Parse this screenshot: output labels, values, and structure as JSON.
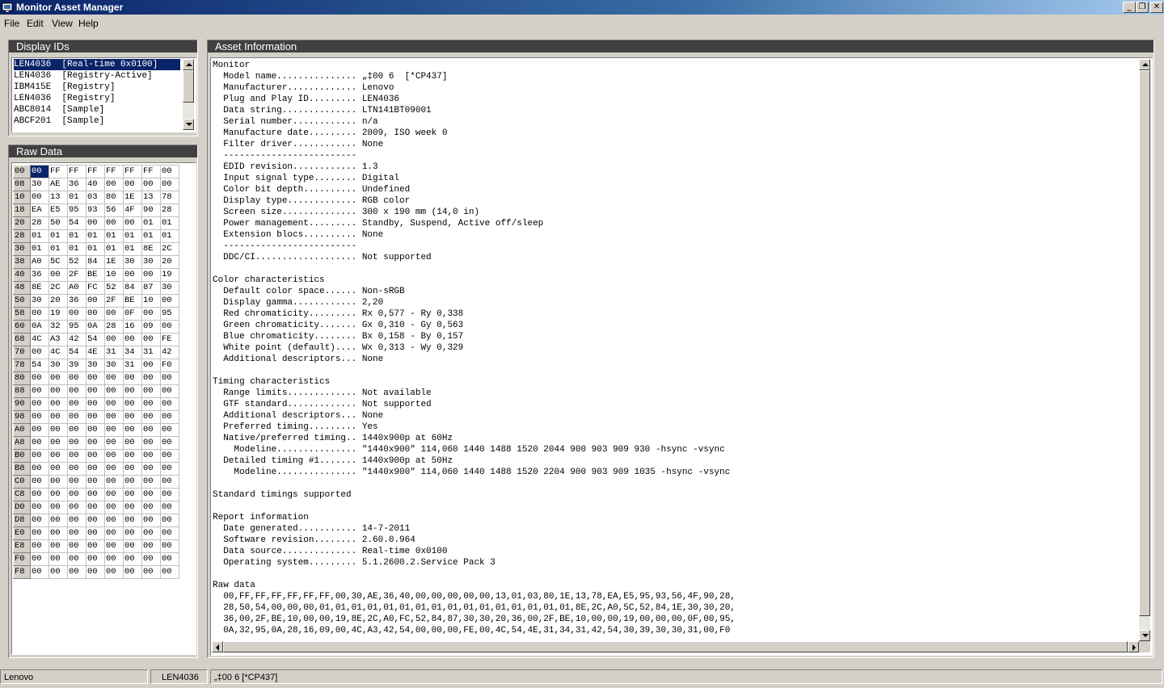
{
  "window": {
    "title": "Monitor Asset Manager"
  },
  "menu": {
    "file": "File",
    "edit": "Edit",
    "view": "View",
    "help": "Help"
  },
  "display_ids": {
    "title": "Display IDs",
    "items": [
      {
        "id": "LEN4036",
        "source": "[Real-time 0x0100]",
        "selected": true
      },
      {
        "id": "LEN4036",
        "source": "[Registry-Active]"
      },
      {
        "id": "IBM415E",
        "source": "[Registry]"
      },
      {
        "id": "LEN4036",
        "source": "[Registry]"
      },
      {
        "id": "ABC8014",
        "source": "[Sample]"
      },
      {
        "id": "ABCF201",
        "source": "[Sample]"
      }
    ]
  },
  "raw_data": {
    "title": "Raw Data",
    "rows": [
      {
        "addr": "00",
        "bytes": [
          "00",
          "FF",
          "FF",
          "FF",
          "FF",
          "FF",
          "FF",
          "00"
        ]
      },
      {
        "addr": "08",
        "bytes": [
          "30",
          "AE",
          "36",
          "40",
          "00",
          "00",
          "00",
          "00"
        ]
      },
      {
        "addr": "10",
        "bytes": [
          "00",
          "13",
          "01",
          "03",
          "80",
          "1E",
          "13",
          "78"
        ]
      },
      {
        "addr": "18",
        "bytes": [
          "EA",
          "E5",
          "95",
          "93",
          "56",
          "4F",
          "90",
          "28"
        ]
      },
      {
        "addr": "20",
        "bytes": [
          "28",
          "50",
          "54",
          "00",
          "00",
          "00",
          "01",
          "01"
        ]
      },
      {
        "addr": "28",
        "bytes": [
          "01",
          "01",
          "01",
          "01",
          "01",
          "01",
          "01",
          "01"
        ]
      },
      {
        "addr": "30",
        "bytes": [
          "01",
          "01",
          "01",
          "01",
          "01",
          "01",
          "8E",
          "2C"
        ]
      },
      {
        "addr": "38",
        "bytes": [
          "A0",
          "5C",
          "52",
          "84",
          "1E",
          "30",
          "30",
          "20"
        ]
      },
      {
        "addr": "40",
        "bytes": [
          "36",
          "00",
          "2F",
          "BE",
          "10",
          "00",
          "00",
          "19"
        ]
      },
      {
        "addr": "48",
        "bytes": [
          "8E",
          "2C",
          "A0",
          "FC",
          "52",
          "84",
          "87",
          "30"
        ]
      },
      {
        "addr": "50",
        "bytes": [
          "30",
          "20",
          "36",
          "00",
          "2F",
          "BE",
          "10",
          "00"
        ]
      },
      {
        "addr": "58",
        "bytes": [
          "00",
          "19",
          "00",
          "00",
          "00",
          "0F",
          "00",
          "95"
        ]
      },
      {
        "addr": "60",
        "bytes": [
          "0A",
          "32",
          "95",
          "0A",
          "28",
          "16",
          "09",
          "00"
        ]
      },
      {
        "addr": "68",
        "bytes": [
          "4C",
          "A3",
          "42",
          "54",
          "00",
          "00",
          "00",
          "FE"
        ]
      },
      {
        "addr": "70",
        "bytes": [
          "00",
          "4C",
          "54",
          "4E",
          "31",
          "34",
          "31",
          "42"
        ]
      },
      {
        "addr": "78",
        "bytes": [
          "54",
          "30",
          "39",
          "30",
          "30",
          "31",
          "00",
          "F0"
        ]
      },
      {
        "addr": "80",
        "bytes": [
          "00",
          "00",
          "00",
          "00",
          "00",
          "00",
          "00",
          "00"
        ]
      },
      {
        "addr": "88",
        "bytes": [
          "00",
          "00",
          "00",
          "00",
          "00",
          "00",
          "00",
          "00"
        ]
      },
      {
        "addr": "90",
        "bytes": [
          "00",
          "00",
          "00",
          "00",
          "00",
          "00",
          "00",
          "00"
        ]
      },
      {
        "addr": "98",
        "bytes": [
          "00",
          "00",
          "00",
          "00",
          "00",
          "00",
          "00",
          "00"
        ]
      },
      {
        "addr": "A0",
        "bytes": [
          "00",
          "00",
          "00",
          "00",
          "00",
          "00",
          "00",
          "00"
        ]
      },
      {
        "addr": "A8",
        "bytes": [
          "00",
          "00",
          "00",
          "00",
          "00",
          "00",
          "00",
          "00"
        ]
      },
      {
        "addr": "B0",
        "bytes": [
          "00",
          "00",
          "00",
          "00",
          "00",
          "00",
          "00",
          "00"
        ]
      },
      {
        "addr": "B8",
        "bytes": [
          "00",
          "00",
          "00",
          "00",
          "00",
          "00",
          "00",
          "00"
        ]
      },
      {
        "addr": "C0",
        "bytes": [
          "00",
          "00",
          "00",
          "00",
          "00",
          "00",
          "00",
          "00"
        ]
      },
      {
        "addr": "C8",
        "bytes": [
          "00",
          "00",
          "00",
          "00",
          "00",
          "00",
          "00",
          "00"
        ]
      },
      {
        "addr": "D0",
        "bytes": [
          "00",
          "00",
          "00",
          "00",
          "00",
          "00",
          "00",
          "00"
        ]
      },
      {
        "addr": "D8",
        "bytes": [
          "00",
          "00",
          "00",
          "00",
          "00",
          "00",
          "00",
          "00"
        ]
      },
      {
        "addr": "E0",
        "bytes": [
          "00",
          "00",
          "00",
          "00",
          "00",
          "00",
          "00",
          "00"
        ]
      },
      {
        "addr": "E8",
        "bytes": [
          "00",
          "00",
          "00",
          "00",
          "00",
          "00",
          "00",
          "00"
        ]
      },
      {
        "addr": "F0",
        "bytes": [
          "00",
          "00",
          "00",
          "00",
          "00",
          "00",
          "00",
          "00"
        ]
      },
      {
        "addr": "F8",
        "bytes": [
          "00",
          "00",
          "00",
          "00",
          "00",
          "00",
          "00",
          "00"
        ]
      }
    ]
  },
  "asset_info": {
    "title": "Asset Information",
    "text": "Monitor\n  Model name............... „‡00 6  [*CP437]\n  Manufacturer............. Lenovo\n  Plug and Play ID......... LEN4036\n  Data string.............. LTN141BT09001\n  Serial number............ n/a\n  Manufacture date......... 2009, ISO week 0\n  Filter driver............ None\n  -------------------------\n  EDID revision............ 1.3\n  Input signal type........ Digital\n  Color bit depth.......... Undefined\n  Display type............. RGB color\n  Screen size.............. 300 x 190 mm (14,0 in)\n  Power management......... Standby, Suspend, Active off/sleep\n  Extension blocs.......... None\n  -------------------------\n  DDC/CI................... Not supported\n\nColor characteristics\n  Default color space...... Non-sRGB\n  Display gamma............ 2,20\n  Red chromaticity......... Rx 0,577 - Ry 0,338\n  Green chromaticity....... Gx 0,310 - Gy 0,563\n  Blue chromaticity........ Bx 0,158 - By 0,157\n  White point (default).... Wx 0,313 - Wy 0,329\n  Additional descriptors... None\n\nTiming characteristics\n  Range limits............. Not available\n  GTF standard............. Not supported\n  Additional descriptors... None\n  Preferred timing......... Yes\n  Native/preferred timing.. 1440x900p at 60Hz\n    Modeline............... \"1440x900\" 114,060 1440 1488 1520 2044 900 903 909 930 -hsync -vsync\n  Detailed timing #1....... 1440x900p at 50Hz\n    Modeline............... \"1440x900\" 114,060 1440 1488 1520 2204 900 903 909 1035 -hsync -vsync\n\nStandard timings supported\n\nReport information\n  Date generated........... 14-7-2011\n  Software revision........ 2.60.0.964\n  Data source.............. Real-time 0x0100\n  Operating system......... 5.1.2600.2.Service Pack 3\n\nRaw data\n  00,FF,FF,FF,FF,FF,FF,00,30,AE,36,40,00,00,00,00,00,13,01,03,80,1E,13,78,EA,E5,95,93,56,4F,90,28,\n  28,50,54,00,00,00,01,01,01,01,01,01,01,01,01,01,01,01,01,01,01,01,8E,2C,A0,5C,52,84,1E,30,30,20,\n  36,00,2F,BE,10,00,00,19,8E,2C,A0,FC,52,84,87,30,30,20,36,00,2F,BE,10,00,00,19,00,00,00,0F,00,95,\n  0A,32,95,0A,28,16,09,00,4C,A3,42,54,00,00,00,FE,00,4C,54,4E,31,34,31,42,54,30,39,30,30,31,00,F0"
  },
  "status_bar": {
    "manufacturer": "Lenovo",
    "pnp_id": "LEN4036",
    "model": "„‡00 6 [*CP437]"
  },
  "colors": {
    "title_bar": "#0a246a",
    "selection": "#0a246a",
    "face": "#d4d0c8",
    "panel_header": "#404040"
  }
}
